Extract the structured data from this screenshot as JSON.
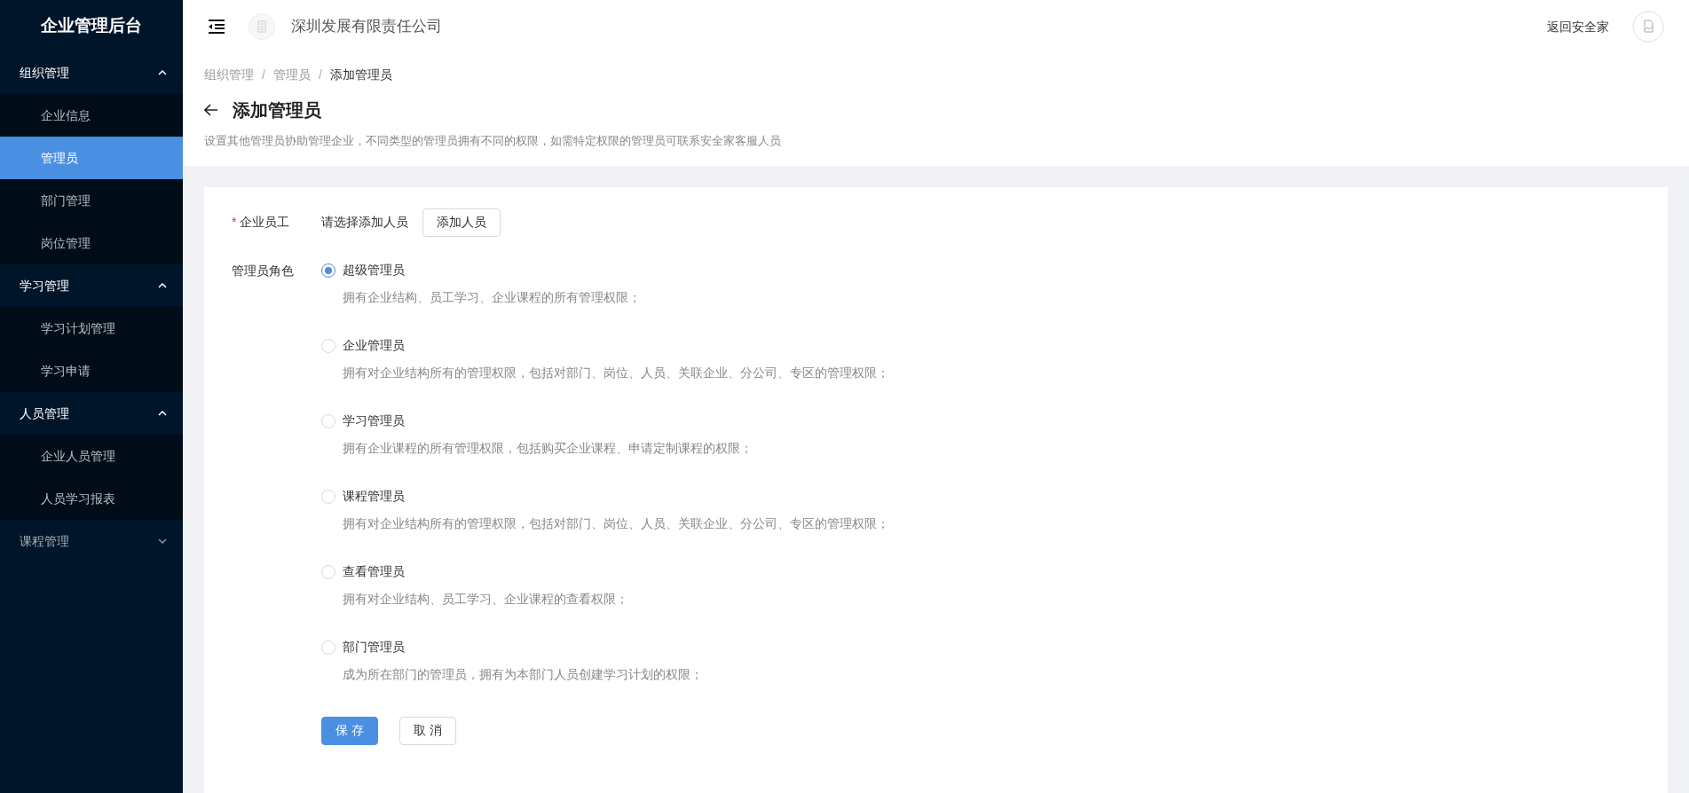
{
  "app_title": "企业管理后台",
  "sidebar": {
    "groups": [
      {
        "label": "组织管理",
        "expanded": true,
        "items": [
          {
            "label": "企业信息",
            "selected": false
          },
          {
            "label": "管理员",
            "selected": true
          },
          {
            "label": "部门管理",
            "selected": false
          },
          {
            "label": "岗位管理",
            "selected": false
          }
        ]
      },
      {
        "label": "学习管理",
        "expanded": true,
        "items": [
          {
            "label": "学习计划管理",
            "selected": false
          },
          {
            "label": "学习申请",
            "selected": false
          }
        ]
      },
      {
        "label": "人员管理",
        "expanded": true,
        "items": [
          {
            "label": "企业人员管理",
            "selected": false
          },
          {
            "label": "人员学习报表",
            "selected": false
          }
        ]
      },
      {
        "label": "课程管理",
        "expanded": false
      }
    ]
  },
  "header": {
    "company": "深圳发展有限责任公司",
    "return_link": "返回安全家"
  },
  "breadcrumb": {
    "items": [
      "组织管理",
      "管理员",
      "添加管理员"
    ],
    "separators": [
      "/",
      "/"
    ]
  },
  "page": {
    "title": "添加管理员",
    "description": "设置其他管理员协助管理企业，不同类型的管理员拥有不同的权限，如需特定权限的管理员可联系安全家客服人员"
  },
  "form": {
    "employee": {
      "label": "企业员工",
      "required_mark": "*",
      "hint": "请选择添加人员",
      "button": "添加人员"
    },
    "role": {
      "label": "管理员角色",
      "options": [
        {
          "label": "超级管理员",
          "description": "拥有企业结构、员工学习、企业课程的所有管理权限；",
          "selected": true
        },
        {
          "label": "企业管理员",
          "description": "拥有对企业结构所有的管理权限，包括对部门、岗位、人员、关联企业、分公司、专区的管理权限；",
          "selected": false
        },
        {
          "label": "学习管理员",
          "description": "拥有企业课程的所有管理权限，包括购买企业课程、申请定制课程的权限；",
          "selected": false
        },
        {
          "label": "课程管理员",
          "description": "拥有对企业结构所有的管理权限，包括对部门、岗位、人员、关联企业、分公司、专区的管理权限；",
          "selected": false
        },
        {
          "label": "查看管理员",
          "description": "拥有对企业结构、员工学习、企业课程的查看权限；",
          "selected": false
        },
        {
          "label": "部门管理员",
          "description": "成为所在部门的管理员，拥有为本部门人员创建学习计划的权限；",
          "selected": false
        }
      ]
    },
    "buttons": [
      {
        "label": "保 存",
        "kind": "primary"
      },
      {
        "label": "取 消",
        "kind": "default"
      }
    ]
  }
}
